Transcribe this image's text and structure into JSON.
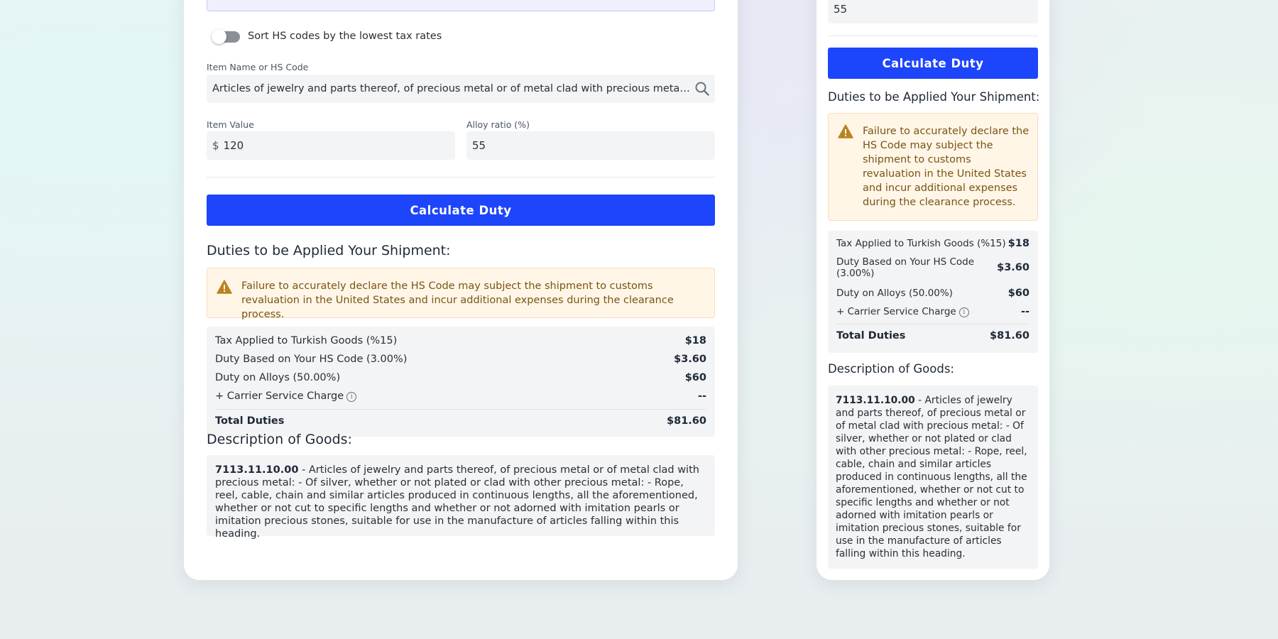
{
  "left": {
    "toggle": {
      "label": "Sort HS codes by the lowest tax rates",
      "on": false
    },
    "item_field": {
      "label": "Item Name or HS Code",
      "value": "Articles of jewelry and parts thereof, of precious metal or of metal clad with precious metal: - Of silver..."
    },
    "value_field": {
      "label": "Item Value",
      "currency": "$",
      "value": "120"
    },
    "alloy_field": {
      "label": "Alloy ratio (%)",
      "value": "55"
    },
    "calculate_label": "Calculate Duty",
    "duties_title": "Duties to be Applied Your Shipment:",
    "warning": "Failure to accurately declare the HS Code may subject the shipment to customs revaluation in the United States and incur additional expenses during the clearance process.",
    "duties": [
      {
        "label": "Tax Applied to Turkish Goods (%15)",
        "value": "$18"
      },
      {
        "label": "Duty Based on Your HS Code (3.00%)",
        "value": "$3.60"
      },
      {
        "label": "Duty on Alloys (50.00%)",
        "value": "$60"
      },
      {
        "label": "+ Carrier Service Charge",
        "value": "--"
      }
    ],
    "total": {
      "label": "Total Duties",
      "value": "$81.60"
    },
    "description_title": "Description of Goods:",
    "description_code": "7113.11.10.00",
    "description_text": " - Articles of jewelry and parts thereof, of precious metal or of metal clad with precious metal: - Of silver, whether or not plated or clad with other precious metal: - Rope, reel, cable, chain and similar articles produced in continuous lengths, all the aforementioned, whether or not cut to specific lengths and whether or not adorned with imitation pearls or imitation precious stones, suitable for use in the manufacture of articles falling within this heading."
  },
  "right": {
    "alloy_value": "55",
    "calculate_label": "Calculate Duty",
    "duties_title": "Duties to be Applied Your Shipment:",
    "warning": "Failure to accurately declare the HS Code may subject the shipment to customs revaluation in the United States and incur additional expenses during the clearance process.",
    "duties": [
      {
        "label": "Tax Applied to Turkish Goods (%15)",
        "value": "$18"
      },
      {
        "label": "Duty Based on Your HS Code (3.00%)",
        "value": "$3.60"
      },
      {
        "label": "Duty on Alloys (50.00%)",
        "value": "$60"
      },
      {
        "label": "+ Carrier Service Charge",
        "value": "--"
      }
    ],
    "total": {
      "label": "Total Duties",
      "value": "$81.60"
    },
    "description_title": "Description of Goods:",
    "description_code": "7113.11.10.00",
    "description_text": " - Articles of jewelry and parts thereof, of precious metal or of metal clad with precious metal: - Of silver, whether or not plated or clad with other precious metal: - Rope, reel, cable, chain and similar articles produced in continuous lengths, all the aforementioned, whether or not cut to specific lengths and whether or not adorned with imitation pearls or imitation precious stones, suitable for use in the manufacture of articles falling within this heading."
  },
  "colors": {
    "primary": "#1d45fb",
    "warning_bg": "#fff6e8",
    "warning_text": "#7a5412",
    "warning_icon": "#b7841f",
    "panel_bg": "#f2f4f5"
  },
  "icons": [
    "search-icon",
    "warning-icon",
    "info-icon",
    "currency-icon"
  ]
}
